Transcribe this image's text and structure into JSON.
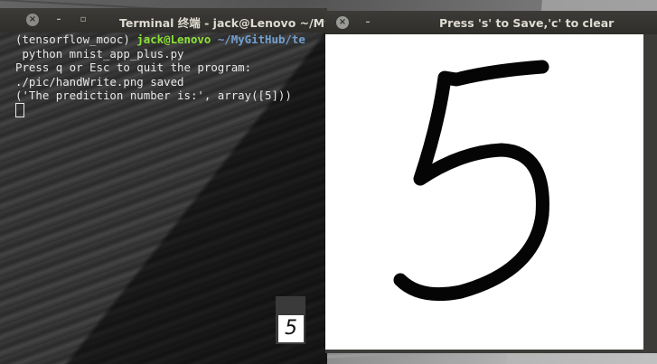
{
  "terminal": {
    "title": "Terminal 终端 - jack@Lenovo ~/MyGitHub/te",
    "close_icon": "×",
    "min_icon": "–",
    "max_icon": "▫",
    "prompt_env": "(tensorflow_mooc)",
    "prompt_user": "jack@Lenovo",
    "prompt_path": "~/MyGitHub/te",
    "lines": [
      " python mnist_app_plus.py",
      "Press q or Esc to quit the program:",
      "./pic/handWrite.png saved",
      "('The prediction number is:', array([5]))"
    ]
  },
  "thumbnail": {
    "digit": "5"
  },
  "draw_window": {
    "title": "Press 's' to Save,'c' to clear",
    "close_icon": "×",
    "min_icon": "–"
  }
}
